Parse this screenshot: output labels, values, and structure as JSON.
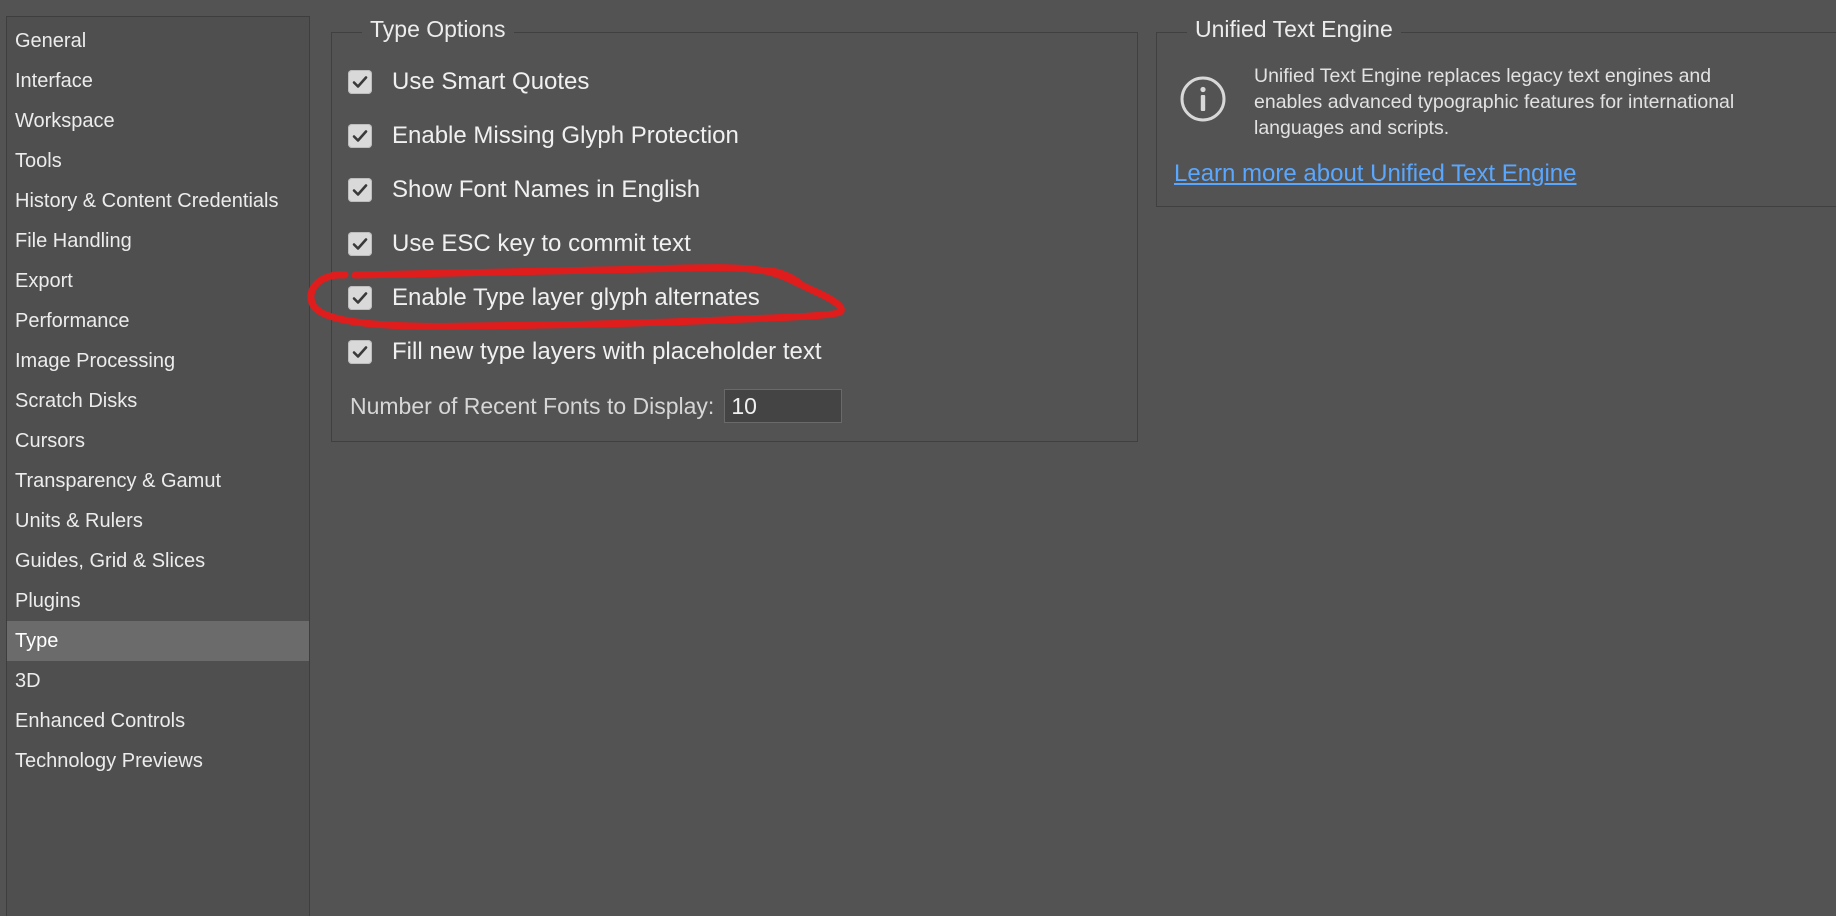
{
  "sidebar": {
    "items": [
      {
        "label": "General"
      },
      {
        "label": "Interface"
      },
      {
        "label": "Workspace"
      },
      {
        "label": "Tools"
      },
      {
        "label": "History & Content Credentials"
      },
      {
        "label": "File Handling"
      },
      {
        "label": "Export"
      },
      {
        "label": "Performance"
      },
      {
        "label": "Image Processing"
      },
      {
        "label": "Scratch Disks"
      },
      {
        "label": "Cursors"
      },
      {
        "label": "Transparency & Gamut"
      },
      {
        "label": "Units & Rulers"
      },
      {
        "label": "Guides, Grid & Slices"
      },
      {
        "label": "Plugins"
      },
      {
        "label": "Type"
      },
      {
        "label": "3D"
      },
      {
        "label": "Enhanced Controls"
      },
      {
        "label": "Technology Previews"
      }
    ],
    "selected": "Type"
  },
  "type_options": {
    "title": "Type Options",
    "checkboxes": [
      {
        "label": "Use Smart Quotes",
        "checked": true
      },
      {
        "label": "Enable Missing Glyph Protection",
        "checked": true
      },
      {
        "label": "Show Font Names in English",
        "checked": true
      },
      {
        "label": "Use ESC key to commit text",
        "checked": true
      },
      {
        "label": "Enable Type layer glyph alternates",
        "checked": true
      },
      {
        "label": "Fill new type layers with placeholder text",
        "checked": true
      }
    ],
    "recent_fonts": {
      "label": "Number of Recent Fonts to Display:",
      "value": "10"
    }
  },
  "unified_text_engine": {
    "title": "Unified Text Engine",
    "description": "Unified Text Engine replaces legacy text engines and enables advanced typographic features for international languages and scripts.",
    "link": "Learn more about Unified Text Engine",
    "icon": "info-icon"
  },
  "annotation": {
    "color": "#e01d1d",
    "target": "Enable Type layer glyph alternates"
  }
}
